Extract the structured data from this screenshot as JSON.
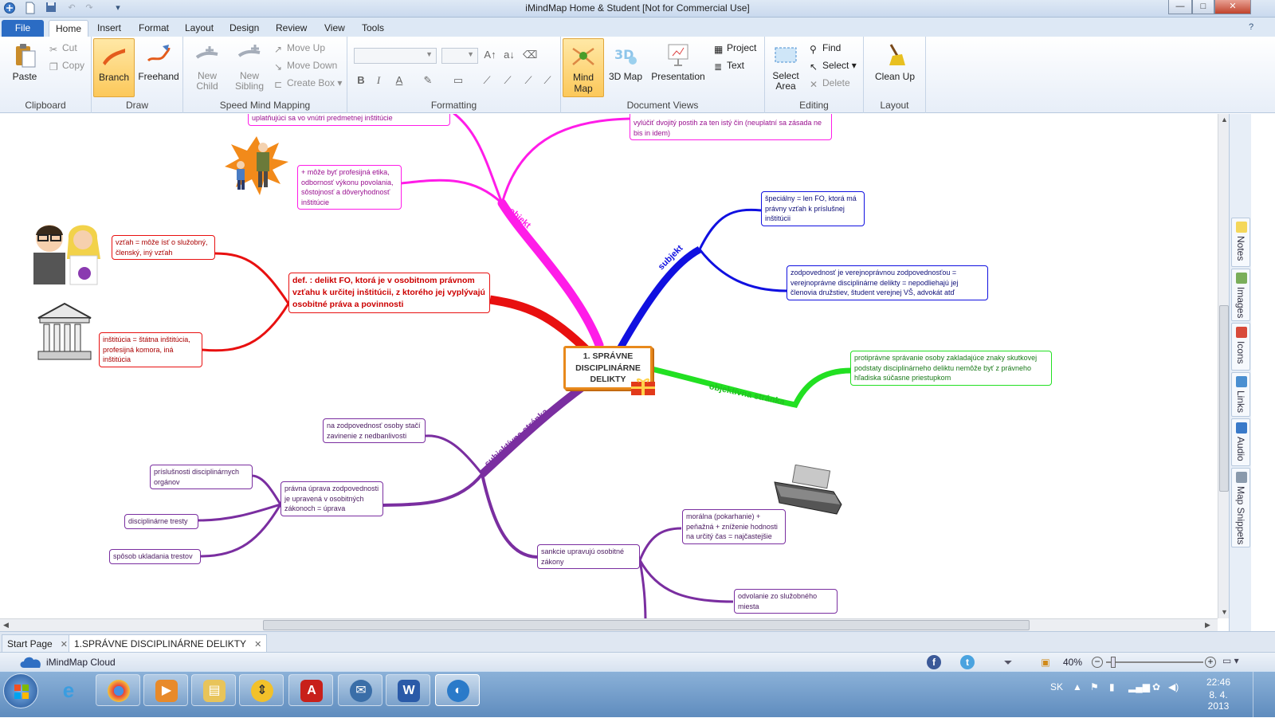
{
  "window": {
    "title": "iMindMap Home & Student [Not for Commercial Use]",
    "controls": {
      "minimize": "—",
      "maximize": "□",
      "close": "✕"
    }
  },
  "menu_tabs": [
    "File",
    "Home",
    "Insert",
    "Format",
    "Layout",
    "Design",
    "Review",
    "View",
    "Tools"
  ],
  "ribbon": {
    "clipboard": {
      "label": "Clipboard",
      "paste": "Paste",
      "cut": "Cut",
      "copy": "Copy"
    },
    "draw": {
      "label": "Draw",
      "branch": "Branch",
      "freehand": "Freehand"
    },
    "speed": {
      "label": "Speed Mind Mapping",
      "new_child": "New Child",
      "new_sibling": "New Sibling",
      "move_up": "Move Up",
      "move_down": "Move Down",
      "create_box": "Create Box"
    },
    "formatting": {
      "label": "Formatting",
      "bold": "B",
      "italic": "I",
      "font_color": "A"
    },
    "document_views": {
      "label": "Document Views",
      "mind_map": "Mind Map",
      "map3d": "3D Map",
      "presentation": "Presentation",
      "project": "Project",
      "text": "Text"
    },
    "editing": {
      "label": "Editing",
      "select_area": "Select Area",
      "find": "Find",
      "select": "Select",
      "delete": "Delete"
    },
    "layout": {
      "label": "Layout",
      "clean_up": "Clean Up"
    }
  },
  "central_topic": {
    "text": "1. SPRÁVNE DISCIPLINÁRNE DELIKTY"
  },
  "branches": {
    "objekt": "objekt",
    "subjekt": "subjekt",
    "objektivna": "objektívna stránka",
    "subjektivna": "subjektívna stránka"
  },
  "nodes": {
    "objekt_top_left": "uplatňujúci sa vo vnútri predmetnej inštitúcie",
    "objekt_top_right": "vylúčiť dvojitý postih za ten istý čin (neuplatní sa zásada ne bis in idem)",
    "objekt_etika": "+ môže byť profesijná etika, odbornosť výkonu povolania, sôstojnosť a dôveryhodnosť inštitúcie",
    "def": "def. : delikt FO, ktorá je v osobitnom právnom vzťahu k určitej inštitúcii, z ktorého jej vyplývajú osobitné práva a povinnosti",
    "vztah": "vzťah = môže ísť o služobný, členský, iný vzťah",
    "institucia": "inštitúcia = štátna inštitúcia, profesijná komora, iná inštitúcia",
    "specialny": "špeciálny = len FO, ktorá má právny vzťah k príslušnej inštitúcii",
    "zodpovednost": "zodpovednosť je verejnoprávnou zodpovednosťou = verejnoprávne disciplinárne delikty = nepodliehajú jej členovia družstiev, študent verejnej VŠ, advokát atď",
    "protipravne": "protiprávne správanie osoby zakladajúce znaky skutkovej podstaty disciplinárneho deliktu nemôže byť z právneho hľadiska súčasne priestupkom",
    "zavinenie": "na zodpovednosť osoby stačí zavinenie z nedbanlivosti",
    "pravna_uprava": "právna úprava zodpovednosti je upravená v osobitných zákonoch = úprava",
    "prislusnosti": "príslušnosti disciplinárnych orgánov",
    "tresty": "disciplinárne tresty",
    "sposob": "spôsob ukladania trestov",
    "sankcie": "sankcie upravujú osobitné zákony",
    "moralna": "morálna (pokarhanie) + peňažná + zníženie hodnosti na určitý čas = najčastejšie",
    "odvolanie": "odvolanie zo služobného miesta"
  },
  "side_panel": [
    "Notes",
    "Images",
    "Icons",
    "Links",
    "Audio",
    "Map Snippets"
  ],
  "doc_tabs": [
    {
      "label": "Start Page"
    },
    {
      "label": "1.SPRÁVNE DISCIPLINÁRNE DELIKTY"
    }
  ],
  "status": {
    "cloud": "iMindMap Cloud",
    "zoom": "40%"
  },
  "taskbar": {
    "language": "SK",
    "time": "22:46",
    "date": "8. 4. 2013"
  },
  "colors": {
    "objekt": "#ff1ce8",
    "subjekt": "#1010e0",
    "objektivna": "#22e022",
    "subjektivna": "#7a2ea0",
    "red": "#e81010"
  }
}
